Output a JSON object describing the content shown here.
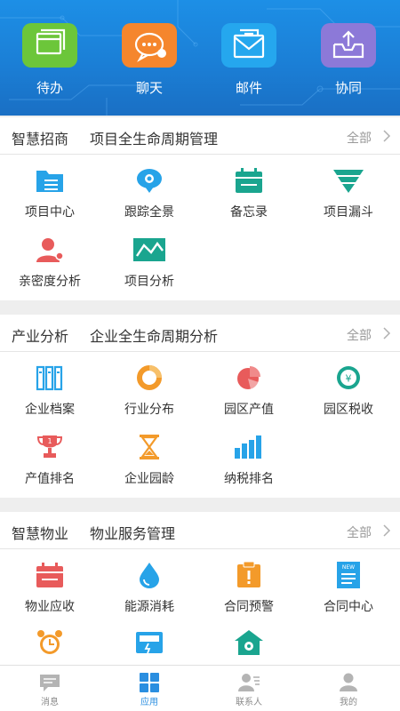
{
  "quick_actions": [
    {
      "label": "待办",
      "icon": "window-stack-icon",
      "color": "#6cc63a"
    },
    {
      "label": "聊天",
      "icon": "chat-bubble-icon",
      "color": "#f5862d"
    },
    {
      "label": "邮件",
      "icon": "envelope-icon",
      "color": "#25a7ee"
    },
    {
      "label": "协同",
      "icon": "inbox-upload-icon",
      "color": "#8c79d8"
    }
  ],
  "sections": [
    {
      "title": "智慧招商",
      "subtitle": "项目全生命周期管理",
      "all_label": "全部",
      "items": [
        {
          "label": "项目中心",
          "icon": "folder-list-icon"
        },
        {
          "label": "跟踪全景",
          "icon": "location-pin-icon"
        },
        {
          "label": "备忘录",
          "icon": "calendar-icon"
        },
        {
          "label": "项目漏斗",
          "icon": "funnel-icon"
        },
        {
          "label": "亲密度分析",
          "icon": "person-icon"
        },
        {
          "label": "项目分析",
          "icon": "line-chart-icon"
        }
      ]
    },
    {
      "title": "产业分析",
      "subtitle": "企业全生命周期分析",
      "all_label": "全部",
      "items": [
        {
          "label": "企业档案",
          "icon": "binders-icon"
        },
        {
          "label": "行业分布",
          "icon": "ring-chart-icon"
        },
        {
          "label": "园区产值",
          "icon": "pie-chart-icon"
        },
        {
          "label": "园区税收",
          "icon": "yen-coin-icon"
        },
        {
          "label": "产值排名",
          "icon": "trophy-icon"
        },
        {
          "label": "企业园龄",
          "icon": "hourglass-icon"
        },
        {
          "label": "纳税排名",
          "icon": "bar-chart-icon"
        }
      ]
    },
    {
      "title": "智慧物业",
      "subtitle": "物业服务管理",
      "all_label": "全部",
      "items": [
        {
          "label": "物业应收",
          "icon": "calendar-red-icon"
        },
        {
          "label": "能源消耗",
          "icon": "water-drop-icon"
        },
        {
          "label": "合同预警",
          "icon": "clipboard-alert-icon"
        },
        {
          "label": "合同中心",
          "icon": "new-document-icon"
        },
        {
          "label": "",
          "icon": "alarm-clock-icon"
        },
        {
          "label": "",
          "icon": "meter-icon"
        },
        {
          "label": "",
          "icon": "house-wrench-icon"
        }
      ]
    }
  ],
  "bottom_nav": [
    {
      "label": "消息",
      "icon": "message-icon",
      "active": false
    },
    {
      "label": "应用",
      "icon": "apps-grid-icon",
      "active": true
    },
    {
      "label": "联系人",
      "icon": "contacts-icon",
      "active": false
    },
    {
      "label": "我的",
      "icon": "profile-icon",
      "active": false
    }
  ],
  "colors": {
    "banner": "#1b7fd6",
    "accent": "#2a8ee0",
    "icon_blue": "#27a3e8",
    "icon_teal": "#1aa58f",
    "icon_red": "#e85b5b",
    "icon_orange": "#f39a2a"
  }
}
